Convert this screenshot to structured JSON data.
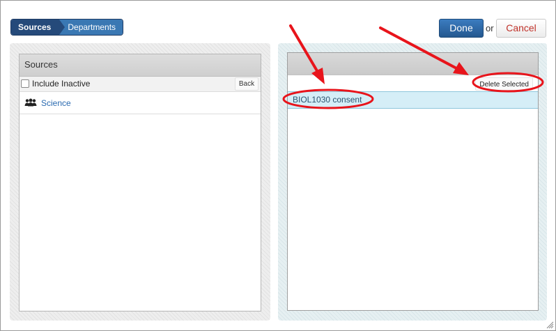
{
  "breadcrumb": {
    "items": [
      "Sources",
      "Departments"
    ]
  },
  "actions": {
    "done_label": "Done",
    "or_text": "or",
    "cancel_label": "Cancel"
  },
  "sources_panel": {
    "title": "Sources",
    "include_inactive_label": "Include Inactive",
    "include_inactive_checked": false,
    "back_label": "Back",
    "items": [
      {
        "label": "Science",
        "icon": "people-icon"
      }
    ]
  },
  "selected_panel": {
    "delete_selected_label": "Delete Selected",
    "items": [
      {
        "label": "BIOL1030 consent"
      }
    ]
  },
  "colors": {
    "primary_button": "#2a64a0",
    "breadcrumb_dark": "#254a7a",
    "breadcrumb_light": "#3a78b3",
    "cancel_text": "#c0322a",
    "link": "#2a6ab0",
    "selected_row": "#d5eef7",
    "annotation": "#e8141b"
  }
}
